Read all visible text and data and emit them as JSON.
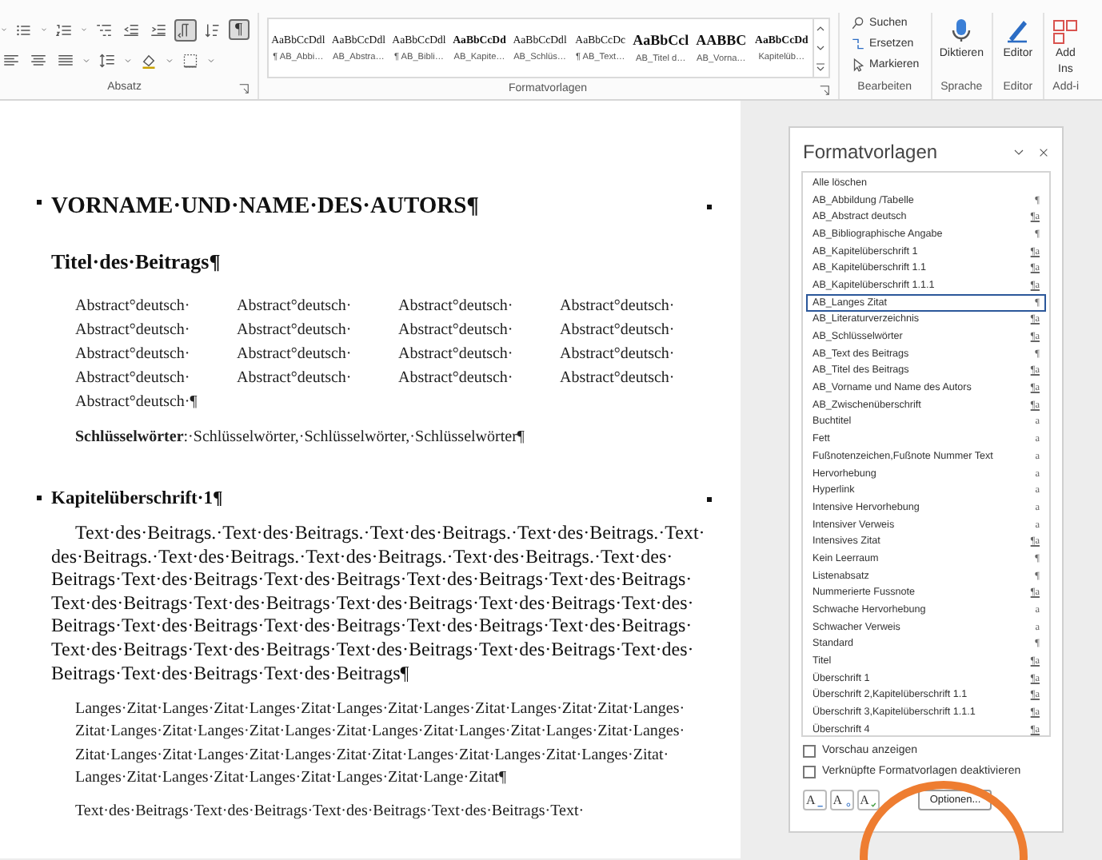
{
  "ribbon": {
    "paragraph_group": {
      "label": "Absatz",
      "text_direction": {
        "on": true
      },
      "formatting_marks": {
        "symbol": "¶",
        "on": true
      }
    },
    "styles_group": {
      "label": "Formatvorlagen",
      "styles": [
        {
          "preview": "AaBbCcDdl",
          "name": "¶ AB_Abbi…",
          "kind": "plain"
        },
        {
          "preview": "AaBbCcDdl",
          "name": "AB_Abstra…",
          "kind": "plain"
        },
        {
          "preview": "AaBbCcDdl",
          "name": "¶ AB_Bibli…",
          "kind": "plain"
        },
        {
          "preview": "AaBbCcDd",
          "name": "AB_Kapite…",
          "kind": "bold"
        },
        {
          "preview": "AaBbCcDdl",
          "name": "AB_Schlüs…",
          "kind": "plain"
        },
        {
          "preview": "AaBbCcDc",
          "name": "¶ AB_Text…",
          "kind": "plain"
        },
        {
          "preview": "AaBbCcl",
          "name": "AB_Titel d…",
          "kind": "title"
        },
        {
          "preview": "AABBC",
          "name": "AB_Vorna…",
          "kind": "title"
        },
        {
          "preview": "AaBbCcDd",
          "name": "Kapitelüb…",
          "kind": "bold"
        }
      ]
    },
    "editing_group": {
      "label": "Bearbeiten",
      "commands": [
        {
          "label": "Suchen",
          "kind": "search"
        },
        {
          "label": "Ersetzen",
          "kind": "replace"
        },
        {
          "label": "Markieren",
          "kind": "select"
        }
      ]
    },
    "voice_group": {
      "label": "Sprache",
      "button": "Diktieren"
    },
    "editor_group": {
      "label": "Editor",
      "button": "Editor"
    },
    "addins_group": {
      "label": "Add-i",
      "button": [
        "Add",
        "Ins"
      ]
    }
  },
  "document": {
    "author": "VORNAME·UND·NAME·DES·AUTORS¶",
    "title": "Titel·des·Beitrags¶",
    "abstract": [
      "Abstract°deutsch·",
      "Abstract°deutsch·",
      "Abstract°deutsch·",
      "Abstract°deutsch·",
      "Abstract°deutsch·",
      "Abstract°deutsch·",
      "Abstract°deutsch·",
      "Abstract°deutsch·",
      "Abstract°deutsch·",
      "Abstract°deutsch·",
      "Abstract°deutsch·",
      "Abstract°deutsch·",
      "Abstract°deutsch·",
      "Abstract°deutsch·",
      "Abstract°deutsch·",
      "Abstract°deutsch·",
      "Abstract°deutsch·¶"
    ],
    "keywords": "**Schlüsselwörter**:·Schlüsselwörter,·Schlüsselwörter,·Schlüsselwörter¶",
    "heading": "Kapitelüberschrift·1¶",
    "body": "Text·des·Beitrags.·Text·des·Beitrags.·Text·des·Beitrags.·Text·des·Beitrags.·Text·des·Beitrags.·Text·des·Beitrags.·Text·des·Beitrags.·Text·des·Beitrags.·Text·des·Beitrags·Text·des·Beitrags·Text·des·Beitrags·Text·des·Beitrags·Text·des·Beitrags·Text·des·Beitrags·Text·des·Beitrags·Text·des·Beitrags·Text·des·Beitrags·Text·des·Beitrags·Text·des·Beitrags·Text·des·Beitrags·Text·des·Beitrags·Text·des·Beitrags·Text·des·Beitrags·Text·des·Beitrags·Text·des·Beitrags·Text·des·Beitrags·Text·des·Beitrags·Text·des·Beitrags·Text·des·Beitrags¶",
    "quote": "Langes·Zitat·Langes·Zitat·Langes·Zitat·Langes·Zitat·Langes·Zitat·Langes·Zitat·Zitat·Langes·Zitat·Langes·Zitat·Langes·Zitat·Langes·Zitat·Langes·Zitat·Langes·Zitat·Langes·Zitat·Langes·Zitat·Langes·Zitat·Langes·Zitat·Langes·Zitat·Zitat·Langes·Zitat·Langes·Zitat·Langes·Zitat·Langes·Zitat·Langes·Zitat·Langes·Zitat·Langes·Zitat·Lange·Zitat¶",
    "next_paragraph": "Text·des·Beitrags·Text·des·Beitrags·Text·des·Beitrags·Text·des·Beitrags·Text·"
  },
  "styles_pane": {
    "title": "Formatvorlagen",
    "items": [
      {
        "name": "Alle löschen",
        "kind": "command",
        "selected": false
      },
      {
        "name": "AB_Abbildung /Tabelle",
        "symbol": "¶",
        "kind": "paragraph",
        "selected": false
      },
      {
        "name": "AB_Abstract deutsch",
        "symbol": "¶a",
        "kind": "linked",
        "selected": false
      },
      {
        "name": "AB_Bibliographische Angabe",
        "symbol": "¶",
        "kind": "paragraph",
        "selected": false
      },
      {
        "name": "AB_Kapitelüberschrift 1",
        "symbol": "¶a",
        "kind": "linked",
        "selected": false
      },
      {
        "name": "AB_Kapitelüberschrift 1.1",
        "symbol": "¶a",
        "kind": "linked",
        "selected": false
      },
      {
        "name": "AB_Kapitelüberschrift 1.1.1",
        "symbol": "¶a",
        "kind": "linked",
        "selected": false
      },
      {
        "name": "AB_Langes Zitat",
        "symbol": "¶",
        "kind": "paragraph",
        "selected": true
      },
      {
        "name": "AB_Literaturverzeichnis",
        "symbol": "¶a",
        "kind": "linked",
        "selected": false
      },
      {
        "name": "AB_Schlüsselwörter",
        "symbol": "¶a",
        "kind": "linked",
        "selected": false
      },
      {
        "name": "AB_Text des Beitrags",
        "symbol": "¶",
        "kind": "paragraph",
        "selected": false
      },
      {
        "name": "AB_Titel des Beitrags",
        "symbol": "¶a",
        "kind": "linked",
        "selected": false
      },
      {
        "name": "AB_Vorname und Name des Autors",
        "symbol": "¶a",
        "kind": "linked",
        "selected": false
      },
      {
        "name": "AB_Zwischenüberschrift",
        "symbol": "¶a",
        "kind": "linked",
        "selected": false
      },
      {
        "name": "Buchtitel",
        "symbol": "a",
        "kind": "character",
        "selected": false
      },
      {
        "name": "Fett",
        "symbol": "a",
        "kind": "character",
        "selected": false
      },
      {
        "name": "Fußnotenzeichen,Fußnote Nummer Text",
        "symbol": "a",
        "kind": "character",
        "selected": false
      },
      {
        "name": "Hervorhebung",
        "symbol": "a",
        "kind": "character",
        "selected": false
      },
      {
        "name": "Hyperlink",
        "symbol": "a",
        "kind": "character",
        "selected": false
      },
      {
        "name": "Intensive Hervorhebung",
        "symbol": "a",
        "kind": "character",
        "selected": false
      },
      {
        "name": "Intensiver Verweis",
        "symbol": "a",
        "kind": "character",
        "selected": false
      },
      {
        "name": "Intensives Zitat",
        "symbol": "¶a",
        "kind": "linked",
        "selected": false
      },
      {
        "name": "Kein Leerraum",
        "symbol": "¶",
        "kind": "paragraph",
        "selected": false
      },
      {
        "name": "Listenabsatz",
        "symbol": "¶",
        "kind": "paragraph",
        "selected": false
      },
      {
        "name": "Nummerierte Fussnote",
        "symbol": "¶a",
        "kind": "linked",
        "selected": false
      },
      {
        "name": "Schwache Hervorhebung",
        "symbol": "a",
        "kind": "character",
        "selected": false
      },
      {
        "name": "Schwacher Verweis",
        "symbol": "a",
        "kind": "character",
        "selected": false
      },
      {
        "name": "Standard",
        "symbol": "¶",
        "kind": "paragraph",
        "selected": false
      },
      {
        "name": "Titel",
        "symbol": "¶a",
        "kind": "linked",
        "selected": false
      },
      {
        "name": "Überschrift 1",
        "symbol": "¶a",
        "kind": "linked",
        "selected": false
      },
      {
        "name": "Überschrift 2,Kapitelüberschrift 1.1",
        "symbol": "¶a",
        "kind": "linked",
        "selected": false
      },
      {
        "name": "Überschrift 3,Kapitelüberschrift 1.1.1",
        "symbol": "¶a",
        "kind": "linked",
        "selected": false
      },
      {
        "name": "Überschrift 4",
        "symbol": "¶a",
        "kind": "linked",
        "selected": false
      }
    ],
    "options": [
      {
        "label": "Vorschau anzeigen",
        "checked": false
      },
      {
        "label": "Verknüpfte Formatvorlagen deaktivieren",
        "checked": false
      }
    ],
    "tool_buttons": [
      {
        "glyph": "A",
        "kind": "new"
      },
      {
        "glyph": "A",
        "kind": "inspect"
      },
      {
        "glyph": "A",
        "kind": "manage"
      }
    ],
    "options_button": "Optionen..."
  },
  "annotation": {
    "kind": "circle"
  }
}
